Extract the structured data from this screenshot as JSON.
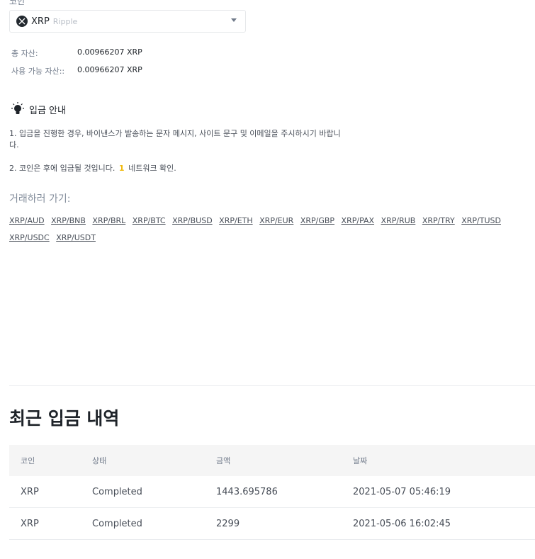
{
  "coin_selector": {
    "label": "코인",
    "symbol": "XRP",
    "name": "Ripple"
  },
  "assets": {
    "total_label": "총 자산:",
    "total_value": "0.00966207 XRP",
    "available_label": "사용 가능 자산::",
    "available_value": "0.00966207 XRP"
  },
  "guide": {
    "title": "입금 안내",
    "line1": "1. 입금을 진행한 경우, 바이낸스가 발송하는 문자 메시지, 사이트 문구 및 이메일을 주시하시기 바랍니다.",
    "line2_prefix": "2. 코인은 후에 입금될 것입니다.",
    "line2_count": "1",
    "line2_suffix": "네트워크 확인."
  },
  "trade": {
    "heading": "거래하러 가기:",
    "pairs": [
      "XRP/AUD",
      "XRP/BNB",
      "XRP/BRL",
      "XRP/BTC",
      "XRP/BUSD",
      "XRP/ETH",
      "XRP/EUR",
      "XRP/GBP",
      "XRP/PAX",
      "XRP/RUB",
      "XRP/TRY",
      "XRP/TUSD",
      "XRP/USDC",
      "XRP/USDT"
    ]
  },
  "history": {
    "title": "최근 입금 내역",
    "columns": [
      "코인",
      "상태",
      "금액",
      "날짜"
    ],
    "rows": [
      {
        "coin": "XRP",
        "status": "Completed",
        "amount": "1443.695786",
        "date": "2021-05-07 05:46:19"
      },
      {
        "coin": "XRP",
        "status": "Completed",
        "amount": "2299",
        "date": "2021-05-06 16:02:45"
      }
    ]
  },
  "colors": {
    "accent": "#f0b90b",
    "text": "#1e2329",
    "muted": "#707a8a"
  }
}
